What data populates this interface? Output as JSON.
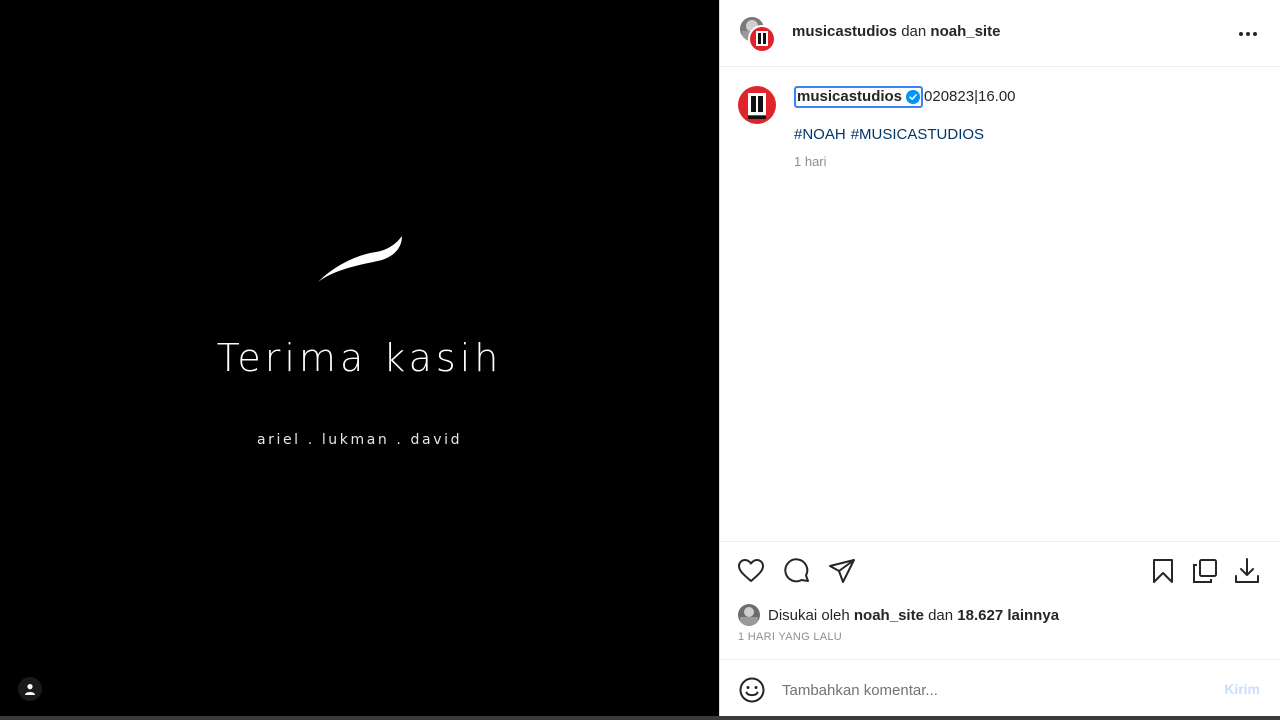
{
  "media": {
    "title": "Terima kasih",
    "subtitle": "ariel . lukman . david"
  },
  "header": {
    "user1": "musicastudios",
    "joiner": "dan",
    "user2": "noah_site"
  },
  "caption": {
    "username": "musicastudios",
    "text": "020823|16.00",
    "hashtags": [
      "#NOAH",
      "#MUSICASTUDIOS"
    ],
    "time": "1 hari"
  },
  "likes": {
    "prefix": "Disukai oleh",
    "user": "noah_site",
    "joiner": "dan",
    "count": "18.627 lainnya"
  },
  "post_time": "1 HARI YANG LALU",
  "comment": {
    "placeholder": "Tambahkan komentar...",
    "send_label": "Kirim"
  },
  "colors": {
    "link": "#00376b",
    "verified": "#0095f6",
    "send_disabled": "#c7dffb",
    "brand_red": "#e0242b"
  }
}
